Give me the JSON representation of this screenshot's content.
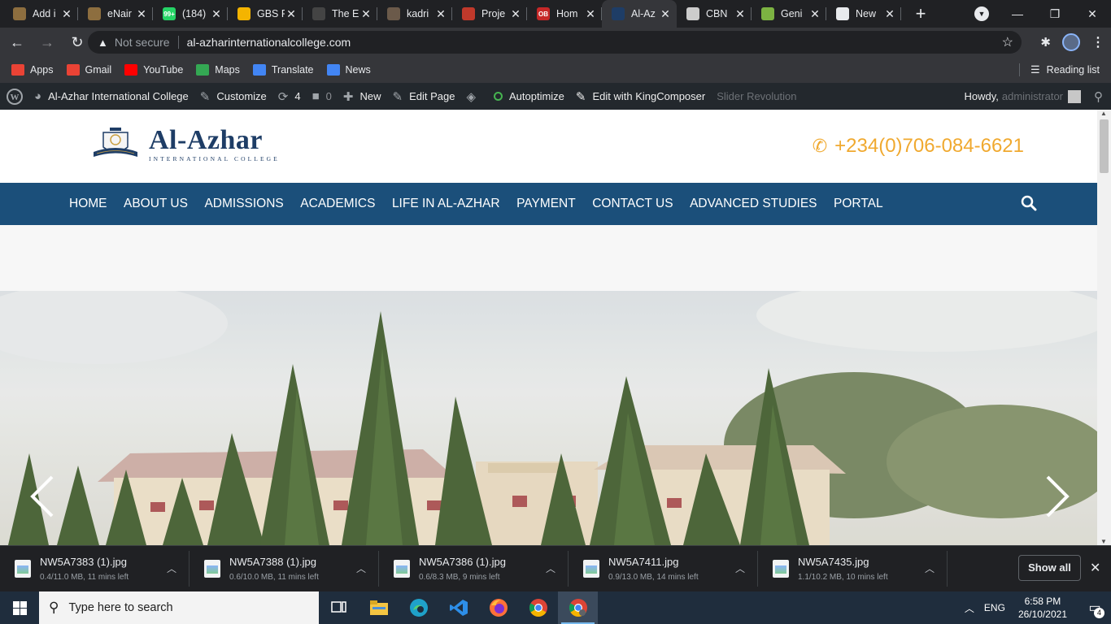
{
  "browser": {
    "tabs": [
      {
        "title": "Add i",
        "favicon": "person-icon",
        "color": "#8d6e3f"
      },
      {
        "title": "eNair",
        "favicon": "person-icon",
        "color": "#8d6e3f"
      },
      {
        "title": "(184)",
        "favicon": "whatsapp-icon",
        "color": "#25d366",
        "badge": "99+"
      },
      {
        "title": "GBS F",
        "favicon": "drive-icon",
        "color": "#f4b400"
      },
      {
        "title": "The E",
        "favicon": "circle-icon",
        "color": "#444444"
      },
      {
        "title": "kadri",
        "favicon": "photo-icon",
        "color": "#6b5a4a"
      },
      {
        "title": "Proje",
        "favicon": "dot-icon",
        "color": "#c0392b"
      },
      {
        "title": "Hom",
        "favicon": "ob-icon",
        "color": "#c62828",
        "badge": "OB"
      },
      {
        "title": "Al-Az",
        "favicon": "site-icon",
        "color": "#1e3d66",
        "active": true
      },
      {
        "title": "CBN",
        "favicon": "dots-icon",
        "color": "#cccccc"
      },
      {
        "title": "Geni",
        "favicon": "android-icon",
        "color": "#7cb342"
      },
      {
        "title": "New",
        "favicon": "chrome-icon",
        "color": "#e8eaed"
      }
    ],
    "omnibox": {
      "security_text": "Not secure",
      "url": "al-azharinternationalcollege.com"
    },
    "bookmarks": [
      {
        "label": "Apps",
        "icon": "apps-grid-icon",
        "color": "#ea4335"
      },
      {
        "label": "Gmail",
        "icon": "gmail-icon",
        "color": "#ea4335"
      },
      {
        "label": "YouTube",
        "icon": "youtube-icon",
        "color": "#ff0000"
      },
      {
        "label": "Maps",
        "icon": "maps-icon",
        "color": "#34a853"
      },
      {
        "label": "Translate",
        "icon": "translate-icon",
        "color": "#4285f4"
      },
      {
        "label": "News",
        "icon": "news-icon",
        "color": "#4285f4"
      }
    ],
    "reading_list": "Reading list"
  },
  "wp_admin": {
    "site_name": "Al-Azhar International College",
    "customize": "Customize",
    "updates": "4",
    "comments": "0",
    "new": "New",
    "edit_page": "Edit Page",
    "autoptimize": "Autoptimize",
    "kingcomposer": "Edit with KingComposer",
    "slider": "Slider Revolution",
    "howdy": "Howdy,",
    "user": "administrator"
  },
  "site": {
    "logo_name": "Al-Azhar",
    "logo_sub": "INTERNATIONAL COLLEGE",
    "phone": "+234(0)706-084-6621",
    "nav": [
      "HOME",
      "ABOUT US",
      "ADMISSIONS",
      "ACADEMICS",
      "LIFE IN AL-AZHAR",
      "PAYMENT",
      "CONTACT US",
      "ADVANCED STUDIES",
      "PORTAL"
    ],
    "colors": {
      "navy": "#1b4f7a",
      "brand": "#1e3d66",
      "accent": "#f0a92f"
    }
  },
  "downloads": [
    {
      "name": "NW5A7383 (1).jpg",
      "meta": "0.4/11.0 MB, 11 mins left"
    },
    {
      "name": "NW5A7388 (1).jpg",
      "meta": "0.6/10.0 MB, 11 mins left"
    },
    {
      "name": "NW5A7386 (1).jpg",
      "meta": "0.6/8.3 MB, 9 mins left"
    },
    {
      "name": "NW5A7411.jpg",
      "meta": "0.9/13.0 MB, 14 mins left"
    },
    {
      "name": "NW5A7435.jpg",
      "meta": "1.1/10.2 MB, 10 mins left"
    }
  ],
  "downloads_show_all": "Show all",
  "taskbar": {
    "search_placeholder": "Type here to search",
    "apps": [
      "task-view-icon",
      "file-explorer-icon",
      "edge-icon",
      "vscode-icon",
      "firefox-icon",
      "chrome-icon",
      "chrome-active-icon"
    ],
    "lang": "ENG",
    "time": "6:58 PM",
    "date": "26/10/2021",
    "notifications": "4"
  }
}
